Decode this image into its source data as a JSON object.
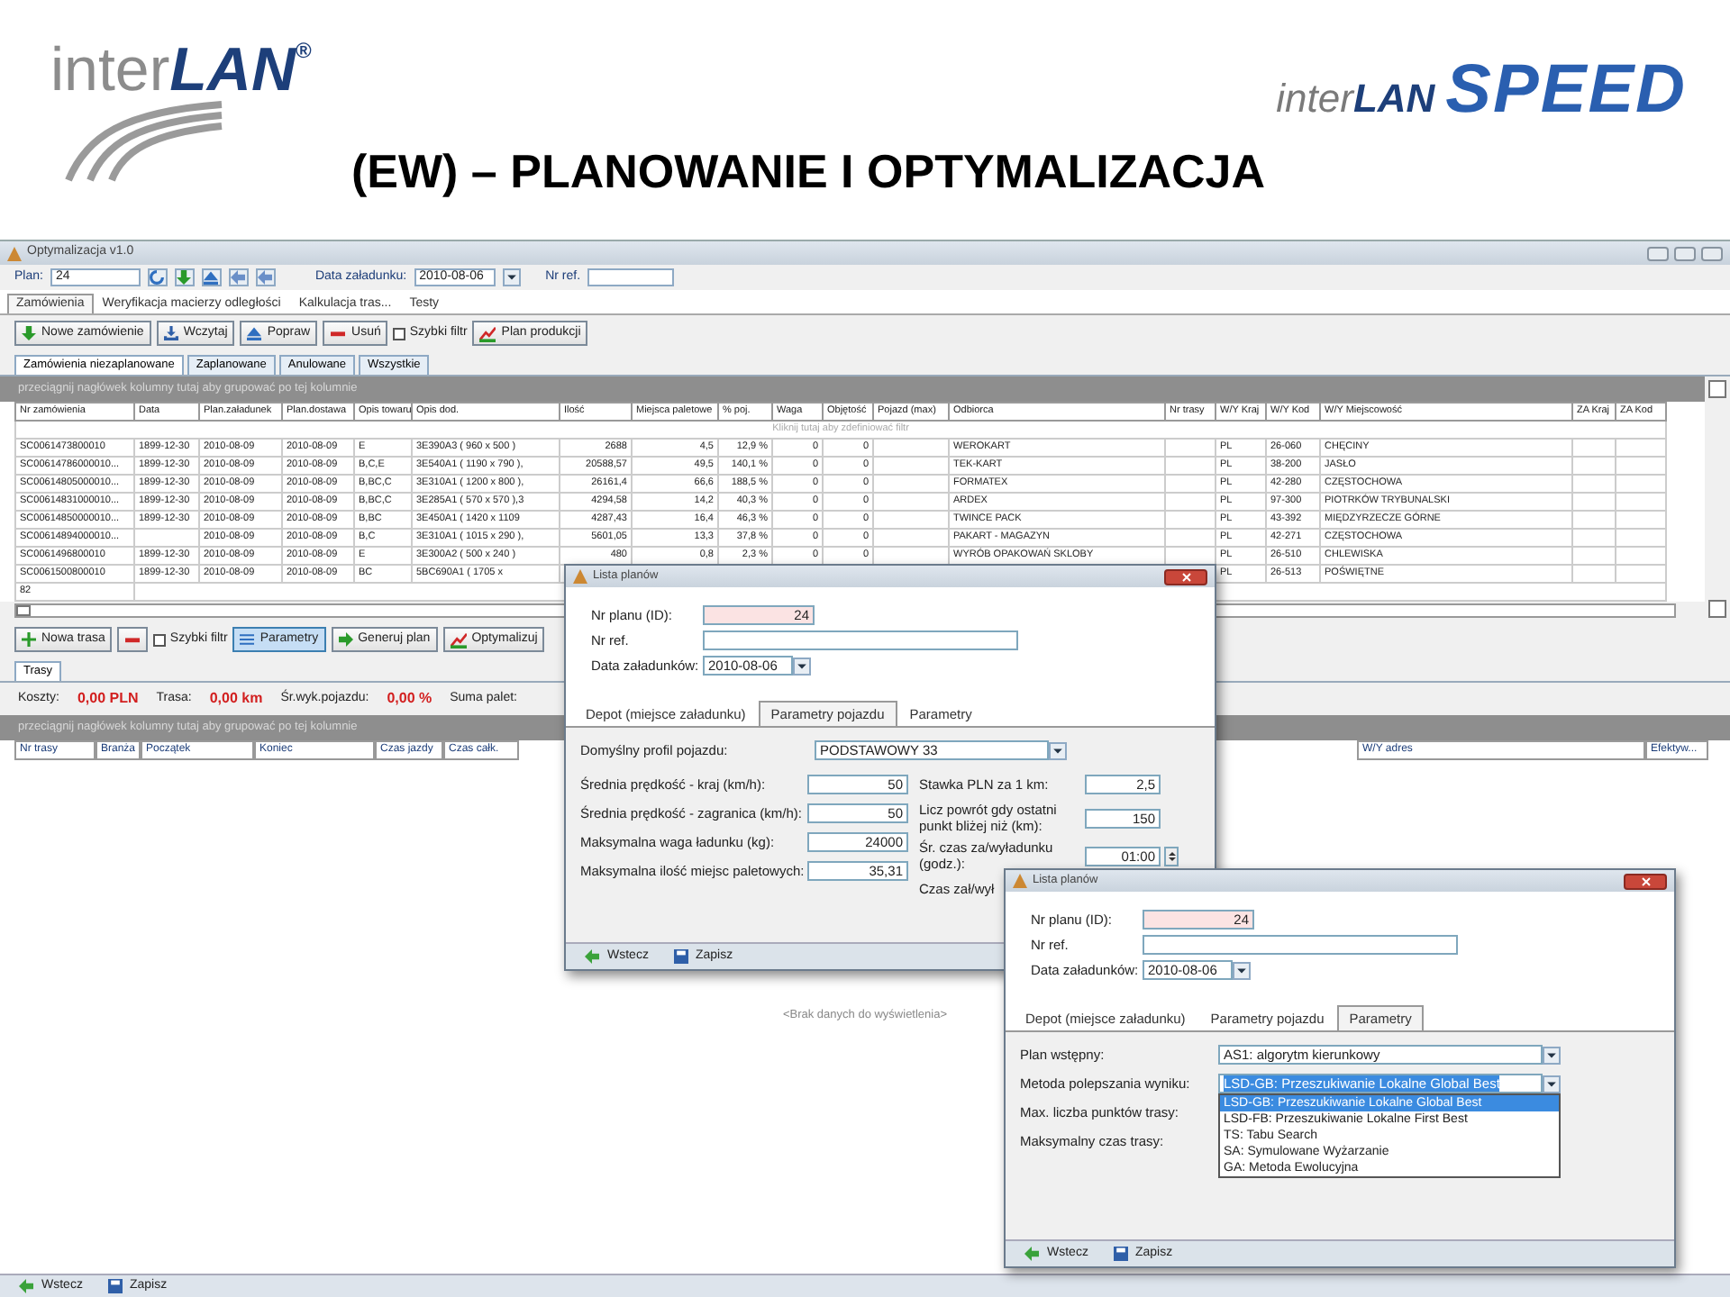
{
  "header": {
    "logo_left": {
      "text_1": "inter",
      "text_2": "LAN",
      "mark": "®"
    },
    "logo_right": {
      "text_1": "inter",
      "text_2": "LAN",
      "text_3": "SPEED"
    },
    "title": "(EW) – PLANOWANIE I OPTYMALIZACJA"
  },
  "app": {
    "title": "Optymalizacja v1.0",
    "plan_label": "Plan:",
    "plan_value": "24",
    "date_label": "Data załadunku:",
    "date_value": "2010-08-06",
    "ref_label": "Nr ref.",
    "tabs": [
      {
        "label": "Zamówienia",
        "selected": true
      },
      {
        "label": "Weryfikacja macierzy odległości",
        "selected": false
      },
      {
        "label": "Kalkulacja tras...",
        "selected": false
      },
      {
        "label": "Testy",
        "selected": false
      }
    ],
    "toolbar": [
      {
        "kind": "button",
        "label": "Nowe zamówienie"
      },
      {
        "kind": "button",
        "label": "Wczytaj"
      },
      {
        "kind": "button",
        "label": "Popraw"
      },
      {
        "kind": "button",
        "label": "Usuń"
      },
      {
        "kind": "checkbox",
        "label": "Szybki filtr",
        "checked": false
      },
      {
        "kind": "button",
        "label": "Plan produkcji"
      }
    ],
    "subtabs": [
      {
        "label": "Zamówienia niezaplanowane",
        "selected": true
      },
      {
        "label": "Zaplanowane",
        "selected": false
      },
      {
        "label": "Anulowane",
        "selected": false
      },
      {
        "label": "Wszystkie",
        "selected": false
      }
    ],
    "group_hint": "przeciągnij nagłówek kolumny tutaj aby grupować po tej kolumnie",
    "orders": {
      "columns": [
        "Nr zamówienia",
        "Data",
        "Plan.załadunek",
        "Plan.dostawa",
        "Opis towaru",
        "Opis dod.",
        "Ilość",
        "Miejsca paletowe",
        "% poj.",
        "Waga",
        "Objętość",
        "Pojazd (max)",
        "Odbiorca",
        "Nr trasy",
        "W/Y Kraj",
        "W/Y Kod",
        "W/Y Miejscowość",
        "ZA Kraj",
        "ZA Kod"
      ],
      "filter_hint": "Kliknij tutaj aby zdefiniować filtr",
      "rows": [
        [
          "SC0061473800010",
          "1899-12-30",
          "2010-08-09",
          "2010-08-09",
          "E",
          "3E390A3 ( 960 x 500 )",
          "2688",
          "4,5",
          "12,9 %",
          "0",
          "0",
          null,
          "WEROKART",
          null,
          "PL",
          "26-060",
          "CHĘCINY",
          null,
          null
        ],
        [
          "SC00614786000010...",
          "1899-12-30",
          "2010-08-09",
          "2010-08-09",
          "B,C,E",
          "3E540A1 ( 1190 x 790 ),",
          "20588,57",
          "49,5",
          "140,1 %",
          "0",
          "0",
          null,
          "TEK-KART",
          null,
          "PL",
          "38-200",
          "JASŁO",
          null,
          null
        ],
        [
          "SC00614805000010...",
          "1899-12-30",
          "2010-08-09",
          "2010-08-09",
          "B,BC,C",
          "3E310A1 ( 1200 x 800 ),",
          "26161,4",
          "66,6",
          "188,5 %",
          "0",
          "0",
          null,
          "FORMATEX",
          null,
          "PL",
          "42-280",
          "CZĘSTOCHOWA",
          null,
          null
        ],
        [
          "SC00614831000010...",
          "1899-12-30",
          "2010-08-09",
          "2010-08-09",
          "B,BC,C",
          "3E285A1 ( 570 x 570 ),3",
          "4294,58",
          "14,2",
          "40,3 %",
          "0",
          "0",
          null,
          "ARDEX",
          null,
          "PL",
          "97-300",
          "PIOTRKÓW TRYBUNALSKI",
          null,
          null
        ],
        [
          "SC00614850000010...",
          "1899-12-30",
          "2010-08-09",
          "2010-08-09",
          "B,BC",
          "3E450A1 ( 1420 x 1109",
          "4287,43",
          "16,4",
          "46,3 %",
          "0",
          "0",
          null,
          "TWINCE PACK",
          null,
          "PL",
          "43-392",
          "MIĘDZYRZECZE GÓRNE",
          null,
          null
        ],
        [
          "SC00614894000010...",
          null,
          "2010-08-09",
          "2010-08-09",
          "B,C",
          "3E310A1 ( 1015 x 290 ),",
          "5601,05",
          "13,3",
          "37,8 %",
          "0",
          "0",
          null,
          "PAKART - MAGAZYN",
          null,
          "PL",
          "42-271",
          "CZĘSTOCHOWA",
          null,
          null
        ],
        [
          "SC0061496800010",
          "1899-12-30",
          "2010-08-09",
          "2010-08-09",
          "E",
          "3E300A2 ( 500 x 240 )",
          "480",
          "0,8",
          "2,3 %",
          "0",
          "0",
          null,
          "WYRÓB OPAKOWAŃ SKLOBY",
          null,
          "PL",
          "26-510",
          "CHLEWISKA",
          null,
          null
        ],
        [
          "SC0061500800010",
          "1899-12-30",
          "2010-08-09",
          "2010-08-09",
          "BC",
          "5BC690A1 ( 1705 x",
          null,
          null,
          null,
          null,
          null,
          null,
          null,
          null,
          "PL",
          "26-513",
          "POŚWIĘTNE",
          null,
          null
        ]
      ],
      "count": "82"
    },
    "route_toolbar": [
      {
        "kind": "button",
        "label": "Nowa trasa",
        "pressed": false
      },
      {
        "kind": "icon_button",
        "pressed": false
      },
      {
        "kind": "checkbox",
        "label": "Szybki filtr",
        "checked": false
      },
      {
        "kind": "button",
        "label": "Parametry",
        "pressed": true
      },
      {
        "kind": "button",
        "label": "Generuj plan",
        "pressed": false
      },
      {
        "kind": "button",
        "label": "Optymalizuj",
        "pressed": false
      }
    ],
    "route_tabs": [
      {
        "label": "Trasy",
        "selected": true
      }
    ],
    "summary": [
      {
        "label": "Koszty:",
        "value": "0,00 PLN"
      },
      {
        "label": "Trasa:",
        "value": "0,00 km"
      },
      {
        "label": "Śr.wyk.pojazdu:",
        "value": "0,00 %"
      },
      {
        "label": "Suma palet:"
      }
    ],
    "routes": {
      "group_hint": "przeciągnij nagłówek kolumny tutaj aby grupować po tej kolumnie",
      "columns": [
        "Nr trasy",
        "Branża",
        "Początek",
        "Koniec",
        "Czas jazdy",
        "Czas całk.",
        null,
        null,
        "W/Y adres",
        "Efektyw..."
      ],
      "empty_text": "<Brak danych do wyświetlenia>"
    },
    "footer": [
      "Wstecz",
      "Zapisz"
    ]
  },
  "dialogs": [
    {
      "title": "Lista planów",
      "id_label": "Nr planu (ID):",
      "id_value": "24",
      "ref_label": "Nr ref.",
      "date_label": "Data załadunków:",
      "date_value": "2010-08-06",
      "tabs": [
        {
          "label": "Depot (miejsce załadunku)",
          "selected": false
        },
        {
          "label": "Parametry pojazdu",
          "selected": true
        },
        {
          "label": "Parametry",
          "selected": false
        }
      ],
      "profile": {
        "label": "Domyślny profil pojazdu:",
        "value": "PODSTAWOWY 33"
      },
      "left_fields": [
        {
          "kind": "text",
          "label": "Średnia prędkość - kraj (km/h):",
          "value": "50"
        },
        {
          "kind": "text",
          "label": "Średnia prędkość - zagranica (km/h):",
          "value": "50"
        },
        {
          "kind": "text",
          "label": "Maksymalna waga ładunku (kg):",
          "value": "24000"
        },
        {
          "kind": "text",
          "label": "Maksymalna ilość miejsc paletowych:",
          "value": "35,31"
        }
      ],
      "right_fields": [
        {
          "kind": "text",
          "label": "Stawka PLN za 1 km:",
          "value": "2,5"
        },
        {
          "kind": "text",
          "label": "Licz powrót gdy ostatni punkt bliżej niż (km):",
          "value": "150"
        },
        {
          "kind": "spin",
          "label": "Śr. czas za/wyładunku (godz.):",
          "value": "01:00"
        },
        {
          "kind": "label",
          "label": "Czas zał/wył"
        }
      ],
      "footer": [
        "Wstecz",
        "Zapisz"
      ]
    },
    {
      "title": "Lista planów",
      "id_label": "Nr planu (ID):",
      "id_value": "24",
      "ref_label": "Nr ref.",
      "date_label": "Data załadunków:",
      "date_value": "2010-08-06",
      "tabs": [
        {
          "label": "Depot (miejsce załadunku)",
          "selected": false
        },
        {
          "label": "Parametry pojazdu",
          "selected": false
        },
        {
          "label": "Parametry",
          "selected": true
        }
      ],
      "left_fields": [
        {
          "kind": "select",
          "label": "Plan wstępny:",
          "value": "AS1: algorytm kierunkowy",
          "focused": false
        },
        {
          "kind": "select",
          "label": "Metoda polepszania wyniku:",
          "value": "LSD-GB: Przeszukiwanie Lokalne Global Best",
          "focused": true
        },
        {
          "kind": "label",
          "label": "Max. liczba punktów trasy:"
        },
        {
          "kind": "label",
          "label": "Maksymalny czas trasy:"
        }
      ],
      "dropdown": [
        {
          "label": "LSD-GB: Przeszukiwanie Lokalne Global Best",
          "selected": true
        },
        {
          "label": "LSD-FB: Przeszukiwanie Lokalne First Best",
          "selected": false
        },
        {
          "label": "TS: Tabu Search",
          "selected": false
        },
        {
          "label": "SA: Symulowane Wyżarzanie",
          "selected": false
        },
        {
          "label": "GA: Metoda Ewolucyjna",
          "selected": false
        }
      ],
      "footer": [
        "Wstecz",
        "Zapisz"
      ]
    }
  ]
}
